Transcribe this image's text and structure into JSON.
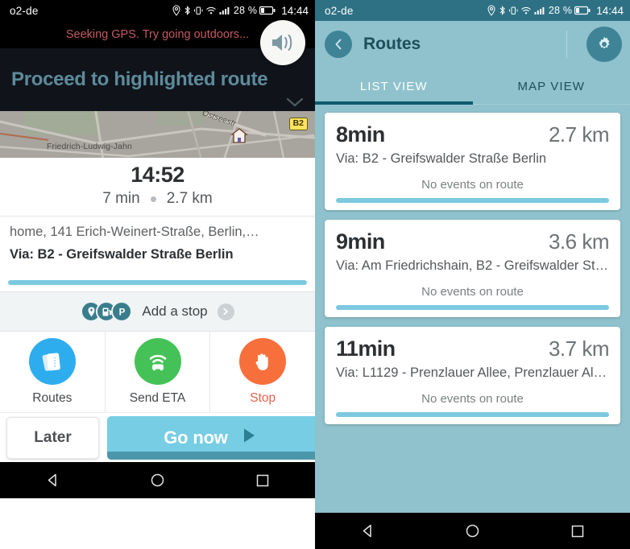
{
  "left": {
    "statusbar": {
      "carrier": "o2-de",
      "battery": "28 %",
      "time": "14:44",
      "icons": [
        "location-icon",
        "bluetooth-icon",
        "vibrate-icon",
        "wifi-icon",
        "signal-icon",
        "battery-icon"
      ]
    },
    "gps_banner": "Seeking GPS. Try going outdoors...",
    "instruction": "Proceed to highlighted route",
    "map": {
      "street_label": "Friedrich-Ludwig-Jahn",
      "street_label_2": "Ostseestr",
      "road_shield": "B2",
      "speaker_icon": "speaker-icon"
    },
    "eta": {
      "arrival_time": "14:52",
      "duration": "7 min",
      "distance": "2.7 km"
    },
    "destination": {
      "address": "home, 141 Erich-Weinert-Straße, Berlin,…",
      "via": "Via: B2 - Greifswalder Straße Berlin"
    },
    "add_stop": {
      "label": "Add a stop",
      "icons": [
        "pin-icon",
        "gas-station-icon",
        "parking-icon"
      ],
      "arrow": "chevron-right-icon"
    },
    "actions": [
      {
        "label": "Routes",
        "icon": "routes-icon",
        "color": "#2eadee"
      },
      {
        "label": "Send ETA",
        "icon": "send-eta-icon",
        "color": "#45c257"
      },
      {
        "label": "Stop",
        "icon": "stop-hand-icon",
        "color": "#f7703c"
      }
    ],
    "bottom": {
      "later_label": "Later",
      "go_now_label": "Go now",
      "go_now_progress": 75,
      "play_icon": "play-icon"
    },
    "navbar": [
      "back-icon",
      "home-icon",
      "recents-icon"
    ]
  },
  "right": {
    "statusbar": {
      "carrier": "o2-de",
      "battery": "28 %",
      "time": "14:44",
      "icons": [
        "location-icon",
        "bluetooth-icon",
        "vibrate-icon",
        "wifi-icon",
        "signal-icon",
        "battery-icon"
      ]
    },
    "header": {
      "back_icon": "chevron-left-icon",
      "title": "Routes",
      "settings_icon": "gear-icon"
    },
    "tabs": [
      {
        "label": "LIST VIEW",
        "active": true
      },
      {
        "label": "MAP VIEW",
        "active": false
      }
    ],
    "routes": [
      {
        "duration": "8min",
        "distance": "2.7 km",
        "via": "Via: B2 - Greifswalder Straße Berlin",
        "events": "No events on route"
      },
      {
        "duration": "9min",
        "distance": "3.6 km",
        "via": "Via: Am Friedrichshain, B2 - Greifswalder Stra…",
        "events": "No events on route"
      },
      {
        "duration": "11min",
        "distance": "3.7 km",
        "via": "Via: L1129 - Prenzlauer Allee, Prenzlauer Allee…",
        "events": "No events on route"
      }
    ],
    "navbar": [
      "back-icon",
      "home-icon",
      "recents-icon"
    ]
  },
  "colors": {
    "accent_blue": "#7cc9e0",
    "header_teal": "#8fc2cc",
    "dark_teal": "#0f5b6e",
    "stop_red": "#e8604b"
  }
}
